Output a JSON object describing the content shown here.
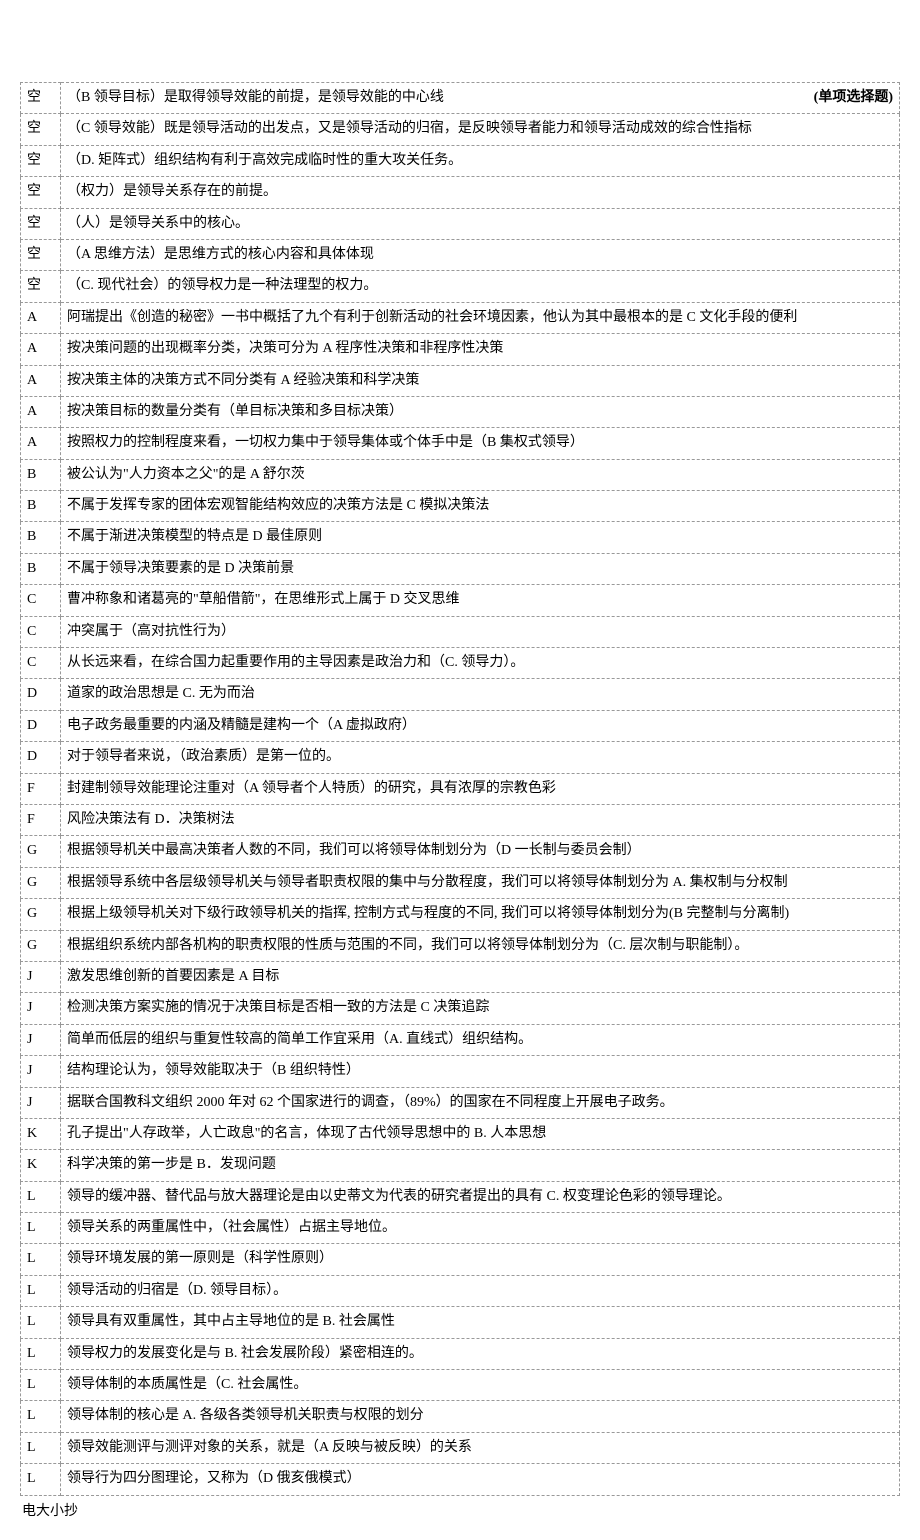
{
  "header_bold": "(单项选择题)",
  "rows": [
    {
      "key": "空",
      "text": "（B 领导目标）是取得领导效能的前提，是领导效能的中心线"
    },
    {
      "key": "空",
      "text": "（C 领导效能）既是领导活动的出发点，又是领导活动的归宿，是反映领导者能力和领导活动成效的综合性指标"
    },
    {
      "key": "空",
      "text": "（D. 矩阵式）组织结构有利于高效完成临时性的重大攻关任务。"
    },
    {
      "key": "空",
      "text": "（权力）是领导关系存在的前提。"
    },
    {
      "key": "空",
      "text": "（人）是领导关系中的核心。"
    },
    {
      "key": "空",
      "text": "（A 思维方法）是思维方式的核心内容和具体体现"
    },
    {
      "key": "空",
      "text": "（C. 现代社会）的领导权力是一种法理型的权力。"
    },
    {
      "key": "A",
      "text": "阿瑞提出《创造的秘密》一书中概括了九个有利于创新活动的社会环境因素，他认为其中最根本的是 C 文化手段的便利"
    },
    {
      "key": "A",
      "text": "按决策问题的出现概率分类，决策可分为 A 程序性决策和非程序性决策"
    },
    {
      "key": "A",
      "text": "按决策主体的决策方式不同分类有 A 经验决策和科学决策"
    },
    {
      "key": "A",
      "text": "按决策目标的数量分类有（单目标决策和多目标决策）"
    },
    {
      "key": "A",
      "text": "按照权力的控制程度来看，一切权力集中于领导集体或个体手中是（B 集权式领导）"
    },
    {
      "key": "B",
      "text": "被公认为\"人力资本之父\"的是 A 舒尔茨"
    },
    {
      "key": "B",
      "text": "不属于发挥专家的团体宏观智能结构效应的决策方法是 C 模拟决策法"
    },
    {
      "key": "B",
      "text": "不属于渐进决策模型的特点是 D 最佳原则"
    },
    {
      "key": "B",
      "text": "不属于领导决策要素的是 D 决策前景"
    },
    {
      "key": "C",
      "text": "曹冲称象和诸葛亮的\"草船借箭\"，在思维形式上属于 D 交叉思维"
    },
    {
      "key": "C",
      "text": "冲突属于（高对抗性行为）"
    },
    {
      "key": "C",
      "text": "从长远来看，在综合国力起重要作用的主导因素是政治力和（C. 领导力）。"
    },
    {
      "key": "D",
      "text": "道家的政治思想是 C. 无为而治"
    },
    {
      "key": "D",
      "text": "电子政务最重要的内涵及精髓是建构一个（A 虚拟政府）"
    },
    {
      "key": "D",
      "text": "对于领导者来说，（政治素质）是第一位的。"
    },
    {
      "key": "F",
      "text": "封建制领导效能理论注重对（A 领导者个人特质）的研究，具有浓厚的宗教色彩"
    },
    {
      "key": "F",
      "text": "风险决策法有 D．决策树法"
    },
    {
      "key": "G",
      "text": "根据领导机关中最高决策者人数的不同，我们可以将领导体制划分为（D 一长制与委员会制）"
    },
    {
      "key": "G",
      "text": "根据领导系统中各层级领导机关与领导者职责权限的集中与分散程度，我们可以将领导体制划分为 A. 集权制与分权制"
    },
    {
      "key": "G",
      "text": "根据上级领导机关对下级行政领导机关的指挥, 控制方式与程度的不同, 我们可以将领导体制划分为(B 完整制与分离制)"
    },
    {
      "key": "G",
      "text": "根据组织系统内部各机构的职责权限的性质与范围的不同，我们可以将领导体制划分为（C. 层次制与职能制）。"
    },
    {
      "key": "J",
      "text": "激发思维创新的首要因素是 A 目标"
    },
    {
      "key": "J",
      "text": "检测决策方案实施的情况于决策目标是否相一致的方法是 C 决策追踪"
    },
    {
      "key": "J",
      "text": "简单而低层的组织与重复性较高的简单工作宜采用（A. 直线式）组织结构。"
    },
    {
      "key": "J",
      "text": "结构理论认为，领导效能取决于（B 组织特性）"
    },
    {
      "key": "J",
      "text": "据联合国教科文组织 2000 年对 62 个国家进行的调查，（89%）的国家在不同程度上开展电子政务。"
    },
    {
      "key": "K",
      "text": "孔子提出\"人存政举，人亡政息\"的名言，体现了古代领导思想中的 B. 人本思想"
    },
    {
      "key": "K",
      "text": "科学决策的第一步是 B．发现问题"
    },
    {
      "key": "L",
      "text": "领导的缓冲器、替代品与放大器理论是由以史蒂文为代表的研究者提出的具有 C. 权变理论色彩的领导理论。"
    },
    {
      "key": "L",
      "text": "领导关系的两重属性中，（社会属性）占据主导地位。"
    },
    {
      "key": "L",
      "text": "领导环境发展的第一原则是（科学性原则）"
    },
    {
      "key": "L",
      "text": "领导活动的归宿是（D. 领导目标）。"
    },
    {
      "key": "L",
      "text": "领导具有双重属性，其中占主导地位的是 B. 社会属性"
    },
    {
      "key": "L",
      "text": "领导权力的发展变化是与 B. 社会发展阶段）紧密相连的。"
    },
    {
      "key": "L",
      "text": "领导体制的本质属性是（C. 社会属性。"
    },
    {
      "key": "L",
      "text": "领导体制的核心是 A. 各级各类领导机关职责与权限的划分"
    },
    {
      "key": "L",
      "text": "领导效能测评与测评对象的关系，就是（A 反映与被反映）的关系"
    },
    {
      "key": "L",
      "text": "领导行为四分图理论，又称为（D 俄亥俄模式）"
    }
  ],
  "footer": "电大小抄"
}
